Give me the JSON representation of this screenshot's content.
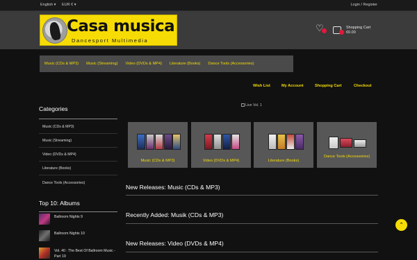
{
  "topbar": {
    "language": "English ▾",
    "currency": "EUR € ▾",
    "auth": "Login / Register"
  },
  "header": {
    "logo_title": "Casa musica",
    "logo_subtitle": "Dancesport Multimedia",
    "cart_title": "Shopping Cart",
    "cart_total": "€0.00"
  },
  "category_nav": [
    "Music (CDs & MP3)",
    "Music (Streaming)",
    "Video (DVDs & MP4)",
    "Literature (Books)",
    "Dance Tools (Accessories)"
  ],
  "secondary_nav": [
    "Wish List",
    "My Account",
    "Shopping Cart",
    "Checkout"
  ],
  "sidebar": {
    "categories_heading": "Categories",
    "categories": [
      "Music (CDs & MP3)",
      "Music (Streaming)",
      "Video (DVDs & MP4)",
      "Literature (Books)",
      "Dance Tools (Accessories)"
    ],
    "top10_heading": "Top 10: Albums",
    "albums": [
      "Ballroom Nights 9",
      "Ballroom Nights 10",
      "Vol. 40 : The Best Of Ballroom Music - Part 19"
    ]
  },
  "main": {
    "banner_alt": "Live Vol. 1",
    "tiles": [
      "Music (CDs & MP3)",
      "Video (DVDs & MP4)",
      "Literature (Books)",
      "Dance Tools (Accessories)"
    ],
    "sections": [
      "New Releases: Music (CDs & MP3)",
      "Recently Added: Musik (CDs & MP3)",
      "New Releases: Video (DVDs & MP4)"
    ]
  },
  "colors": {
    "accent": "#f6dc04",
    "background": "#111111",
    "header": "#3b3b3b",
    "nav": "#4a4a4a",
    "tile": "#575757",
    "badge": "#e5173a"
  },
  "icons": {
    "wish": "heart-icon",
    "cart": "shopping-bag-icon",
    "scroll_top": "chevron-up-icon"
  }
}
